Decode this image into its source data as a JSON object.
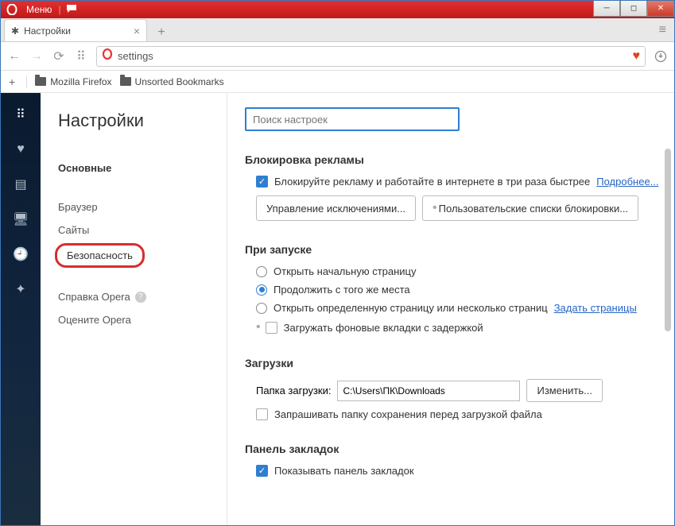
{
  "titlebar": {
    "menu": "Меню"
  },
  "tab": {
    "title": "Настройки"
  },
  "addressbar": {
    "value": "settings"
  },
  "bookmarks": {
    "item1": "Mozilla Firefox",
    "item2": "Unsorted Bookmarks"
  },
  "sidenav": {
    "title": "Настройки",
    "basic": "Основные",
    "browser": "Браузер",
    "sites": "Сайты",
    "security": "Безопасность",
    "help": "Справка Opera",
    "rate": "Оцените Opera"
  },
  "search": {
    "placeholder": "Поиск настроек"
  },
  "adblock": {
    "heading": "Блокировка рекламы",
    "checkbox_label": "Блокируйте рекламу и работайте в интернете в три раза быстрее",
    "learn_more": "Подробнее...",
    "btn_exceptions": "Управление исключениями...",
    "btn_lists": "Пользовательские списки блокировки..."
  },
  "startup": {
    "heading": "При запуске",
    "opt1": "Открыть начальную страницу",
    "opt2": "Продолжить с того же места",
    "opt3": "Открыть определенную страницу или несколько страниц",
    "set_pages": "Задать страницы",
    "delay_bg": "Загружать фоновые вкладки с задержкой"
  },
  "downloads": {
    "heading": "Загрузки",
    "folder_label": "Папка загрузки:",
    "folder_path": "C:\\Users\\ПК\\Downloads",
    "change_btn": "Изменить...",
    "ask_checkbox": "Запрашивать папку сохранения перед загрузкой файла"
  },
  "bookmarks_panel": {
    "heading": "Панель закладок",
    "show_checkbox": "Показывать панель закладок"
  }
}
